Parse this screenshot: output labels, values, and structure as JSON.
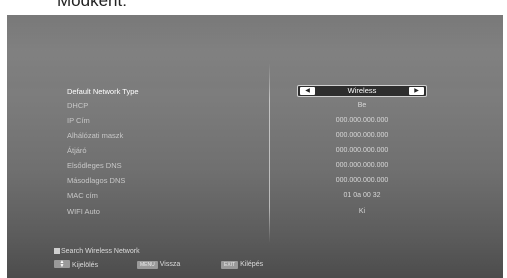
{
  "caption": "Módkent:",
  "settings": {
    "rows": [
      {
        "label": "Default Network Type",
        "value": "Wireless"
      },
      {
        "label": "DHCP",
        "value": "Be"
      },
      {
        "label": "IP Cím",
        "value": "000.000.000.000"
      },
      {
        "label": "Alhálózati maszk",
        "value": "000.000.000.000"
      },
      {
        "label": "Átjáró",
        "value": "000.000.000.000"
      },
      {
        "label": "Elsődleges DNS",
        "value": "000.000.000.000"
      },
      {
        "label": "Másodlagos DNS",
        "value": "000.000.000.000"
      },
      {
        "label": "MAC cím",
        "value": "01 0a 00 32"
      },
      {
        "label": "WIFI Auto",
        "value": "Ki"
      }
    ]
  },
  "hints": {
    "search": "Search Wireless Network",
    "select_label": "Kijelölés",
    "menu_key": "MENU",
    "back_label": "Vissza",
    "exit_key": "EXIT",
    "exit_label": "Kilépés"
  },
  "icons": {
    "left": "arrow-left-icon",
    "right": "arrow-right-icon",
    "updown": "up-down-arrows-icon"
  },
  "colors": {
    "panel": "#6f6f6f",
    "selector_bg": "#2e2e2e"
  }
}
